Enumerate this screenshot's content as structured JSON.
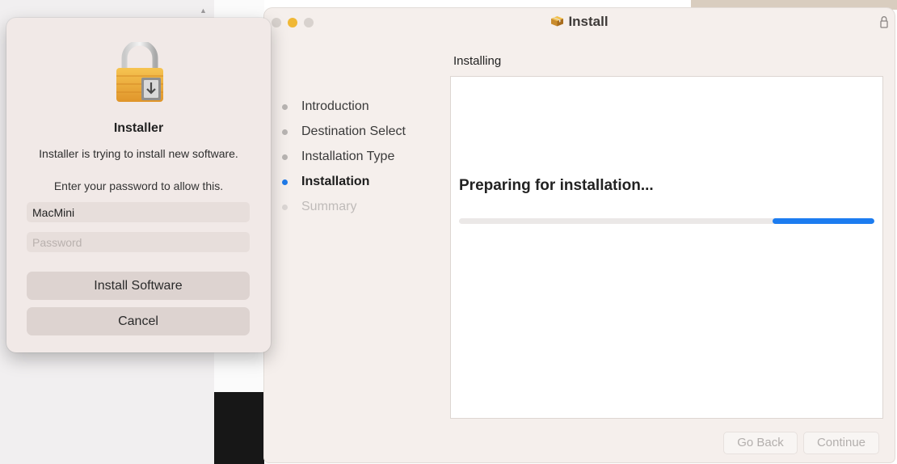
{
  "installer_window": {
    "title": "Install",
    "current_step_header": "Installing",
    "steps": [
      {
        "label": "Introduction",
        "state": "done"
      },
      {
        "label": "Destination Select",
        "state": "done"
      },
      {
        "label": "Installation Type",
        "state": "done"
      },
      {
        "label": "Installation",
        "state": "active"
      },
      {
        "label": "Summary",
        "state": "pending"
      }
    ],
    "status_text": "Preparing for installation...",
    "progress": {
      "indeterminate": true,
      "fill_start": 0.755,
      "fill_end": 1.0
    },
    "buttons": {
      "go_back": "Go Back",
      "continue": "Continue"
    },
    "colors": {
      "accent": "#1c7cf0",
      "close_button": "#d8d2ce",
      "minimize_button": "#f0b836"
    },
    "icons": {
      "title_icon": "package-icon",
      "lock_icon": "lock-icon"
    }
  },
  "auth_dialog": {
    "icon": "padlock-installer-icon",
    "title": "Installer",
    "message": "Installer is trying to install new software.",
    "prompt": "Enter your password to allow this.",
    "username_value": "MacMini",
    "password_placeholder": "Password",
    "install_button": "Install Software",
    "cancel_button": "Cancel"
  }
}
